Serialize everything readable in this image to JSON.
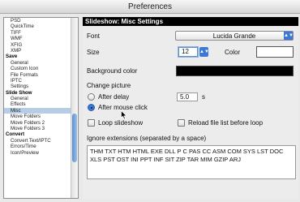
{
  "window": {
    "title": "Preferences"
  },
  "sidebar": {
    "items": [
      {
        "label": "PSD",
        "head": false
      },
      {
        "label": "QuickTime",
        "head": false
      },
      {
        "label": "TIFF",
        "head": false
      },
      {
        "label": "WMF",
        "head": false
      },
      {
        "label": "XFIG",
        "head": false
      },
      {
        "label": "XMP",
        "head": false
      },
      {
        "label": "Save",
        "head": true
      },
      {
        "label": "General",
        "head": false
      },
      {
        "label": "Custom Icon",
        "head": false
      },
      {
        "label": "File Formats",
        "head": false
      },
      {
        "label": "IPTC",
        "head": false
      },
      {
        "label": "Settings",
        "head": false
      },
      {
        "label": "Slide Show",
        "head": true
      },
      {
        "label": "General",
        "head": false
      },
      {
        "label": "Effects",
        "head": false
      },
      {
        "label": "Misc",
        "head": false,
        "selected": true
      },
      {
        "label": "Move Folders",
        "head": false
      },
      {
        "label": "Move Folders 2",
        "head": false
      },
      {
        "label": "Move Folders 3",
        "head": false
      },
      {
        "label": "Convert",
        "head": true
      },
      {
        "label": "Convert Text/IPTC",
        "head": false
      },
      {
        "label": "Errors/Time",
        "head": false
      },
      {
        "label": "Icon/Preview",
        "head": false
      }
    ]
  },
  "panel": {
    "title": "Slideshow: Misc Settings",
    "font_label": "Font",
    "font_value": "Lucida Grande",
    "size_label": "Size",
    "size_value": "12",
    "color_label": "Color",
    "bg_color_label": "Background color",
    "change_picture_label": "Change picture",
    "after_delay_label": "After delay",
    "delay_value": "5.0",
    "delay_unit": "s",
    "after_click_label": "After mouse click",
    "change_mode": "after-mouse-click",
    "loop_label": "Loop slideshow",
    "reload_label": "Reload file list before loop",
    "ignore_label": "Ignore extensions (separated by a space)",
    "ignore_value": "THM TXT HTM HTML EXE DLL P C PAS CC ASM COM SYS LST DOC XLS PST OST INI PPT INF SIT ZIP TAR MIM GZIP ARJ"
  },
  "colors": {
    "text_color_well": "#ffffff",
    "background_color_well": "#000000",
    "accent": "#3c78d8"
  }
}
